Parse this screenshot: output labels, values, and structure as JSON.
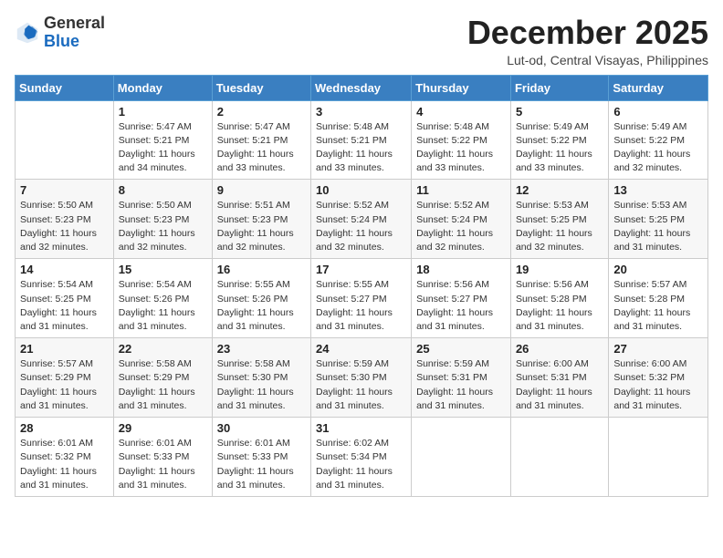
{
  "header": {
    "logo": {
      "general": "General",
      "blue": "Blue"
    },
    "title": "December 2025",
    "location": "Lut-od, Central Visayas, Philippines"
  },
  "weekdays": [
    "Sunday",
    "Monday",
    "Tuesday",
    "Wednesday",
    "Thursday",
    "Friday",
    "Saturday"
  ],
  "weeks": [
    [
      {
        "day": "",
        "info": ""
      },
      {
        "day": "1",
        "info": "Sunrise: 5:47 AM\nSunset: 5:21 PM\nDaylight: 11 hours\nand 34 minutes."
      },
      {
        "day": "2",
        "info": "Sunrise: 5:47 AM\nSunset: 5:21 PM\nDaylight: 11 hours\nand 33 minutes."
      },
      {
        "day": "3",
        "info": "Sunrise: 5:48 AM\nSunset: 5:21 PM\nDaylight: 11 hours\nand 33 minutes."
      },
      {
        "day": "4",
        "info": "Sunrise: 5:48 AM\nSunset: 5:22 PM\nDaylight: 11 hours\nand 33 minutes."
      },
      {
        "day": "5",
        "info": "Sunrise: 5:49 AM\nSunset: 5:22 PM\nDaylight: 11 hours\nand 33 minutes."
      },
      {
        "day": "6",
        "info": "Sunrise: 5:49 AM\nSunset: 5:22 PM\nDaylight: 11 hours\nand 32 minutes."
      }
    ],
    [
      {
        "day": "7",
        "info": "Sunrise: 5:50 AM\nSunset: 5:23 PM\nDaylight: 11 hours\nand 32 minutes."
      },
      {
        "day": "8",
        "info": "Sunrise: 5:50 AM\nSunset: 5:23 PM\nDaylight: 11 hours\nand 32 minutes."
      },
      {
        "day": "9",
        "info": "Sunrise: 5:51 AM\nSunset: 5:23 PM\nDaylight: 11 hours\nand 32 minutes."
      },
      {
        "day": "10",
        "info": "Sunrise: 5:52 AM\nSunset: 5:24 PM\nDaylight: 11 hours\nand 32 minutes."
      },
      {
        "day": "11",
        "info": "Sunrise: 5:52 AM\nSunset: 5:24 PM\nDaylight: 11 hours\nand 32 minutes."
      },
      {
        "day": "12",
        "info": "Sunrise: 5:53 AM\nSunset: 5:25 PM\nDaylight: 11 hours\nand 32 minutes."
      },
      {
        "day": "13",
        "info": "Sunrise: 5:53 AM\nSunset: 5:25 PM\nDaylight: 11 hours\nand 31 minutes."
      }
    ],
    [
      {
        "day": "14",
        "info": "Sunrise: 5:54 AM\nSunset: 5:25 PM\nDaylight: 11 hours\nand 31 minutes."
      },
      {
        "day": "15",
        "info": "Sunrise: 5:54 AM\nSunset: 5:26 PM\nDaylight: 11 hours\nand 31 minutes."
      },
      {
        "day": "16",
        "info": "Sunrise: 5:55 AM\nSunset: 5:26 PM\nDaylight: 11 hours\nand 31 minutes."
      },
      {
        "day": "17",
        "info": "Sunrise: 5:55 AM\nSunset: 5:27 PM\nDaylight: 11 hours\nand 31 minutes."
      },
      {
        "day": "18",
        "info": "Sunrise: 5:56 AM\nSunset: 5:27 PM\nDaylight: 11 hours\nand 31 minutes."
      },
      {
        "day": "19",
        "info": "Sunrise: 5:56 AM\nSunset: 5:28 PM\nDaylight: 11 hours\nand 31 minutes."
      },
      {
        "day": "20",
        "info": "Sunrise: 5:57 AM\nSunset: 5:28 PM\nDaylight: 11 hours\nand 31 minutes."
      }
    ],
    [
      {
        "day": "21",
        "info": "Sunrise: 5:57 AM\nSunset: 5:29 PM\nDaylight: 11 hours\nand 31 minutes."
      },
      {
        "day": "22",
        "info": "Sunrise: 5:58 AM\nSunset: 5:29 PM\nDaylight: 11 hours\nand 31 minutes."
      },
      {
        "day": "23",
        "info": "Sunrise: 5:58 AM\nSunset: 5:30 PM\nDaylight: 11 hours\nand 31 minutes."
      },
      {
        "day": "24",
        "info": "Sunrise: 5:59 AM\nSunset: 5:30 PM\nDaylight: 11 hours\nand 31 minutes."
      },
      {
        "day": "25",
        "info": "Sunrise: 5:59 AM\nSunset: 5:31 PM\nDaylight: 11 hours\nand 31 minutes."
      },
      {
        "day": "26",
        "info": "Sunrise: 6:00 AM\nSunset: 5:31 PM\nDaylight: 11 hours\nand 31 minutes."
      },
      {
        "day": "27",
        "info": "Sunrise: 6:00 AM\nSunset: 5:32 PM\nDaylight: 11 hours\nand 31 minutes."
      }
    ],
    [
      {
        "day": "28",
        "info": "Sunrise: 6:01 AM\nSunset: 5:32 PM\nDaylight: 11 hours\nand 31 minutes."
      },
      {
        "day": "29",
        "info": "Sunrise: 6:01 AM\nSunset: 5:33 PM\nDaylight: 11 hours\nand 31 minutes."
      },
      {
        "day": "30",
        "info": "Sunrise: 6:01 AM\nSunset: 5:33 PM\nDaylight: 11 hours\nand 31 minutes."
      },
      {
        "day": "31",
        "info": "Sunrise: 6:02 AM\nSunset: 5:34 PM\nDaylight: 11 hours\nand 31 minutes."
      },
      {
        "day": "",
        "info": ""
      },
      {
        "day": "",
        "info": ""
      },
      {
        "day": "",
        "info": ""
      }
    ]
  ]
}
